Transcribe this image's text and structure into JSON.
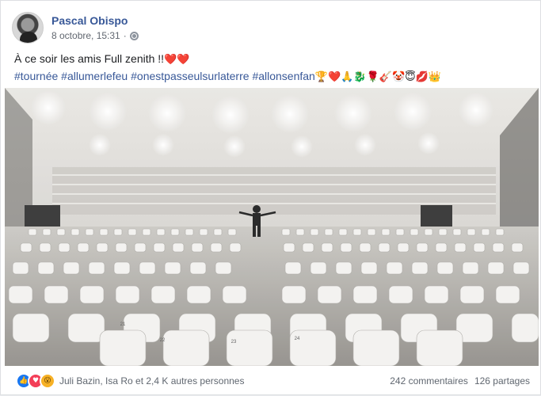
{
  "post": {
    "author": "Pascal Obispo",
    "date": "8 octobre, 15:31",
    "separator": "·",
    "audience_icon": "globe-icon",
    "text_main": "À ce soir les amis Full zenith !!",
    "text_main_emoji": "❤️❤️",
    "hashtags": [
      "#tournée",
      "#allumerlefeu",
      "#onestpasseulsurlaterre",
      "#allonsenfan"
    ],
    "hashtag_emoji": "🏆❤️🙏🐉🌹🎸🤡😇💋👑"
  },
  "footer": {
    "reactions": [
      "like-icon",
      "love-icon",
      "wow-icon"
    ],
    "reaction_names": "Juli Bazin, Isa Ro et 2,4 K autres personnes",
    "comments": "242 commentaires",
    "shares": "126 partages"
  },
  "photo": {
    "seat_numbers": [
      "21",
      "22",
      "23",
      "24"
    ]
  }
}
